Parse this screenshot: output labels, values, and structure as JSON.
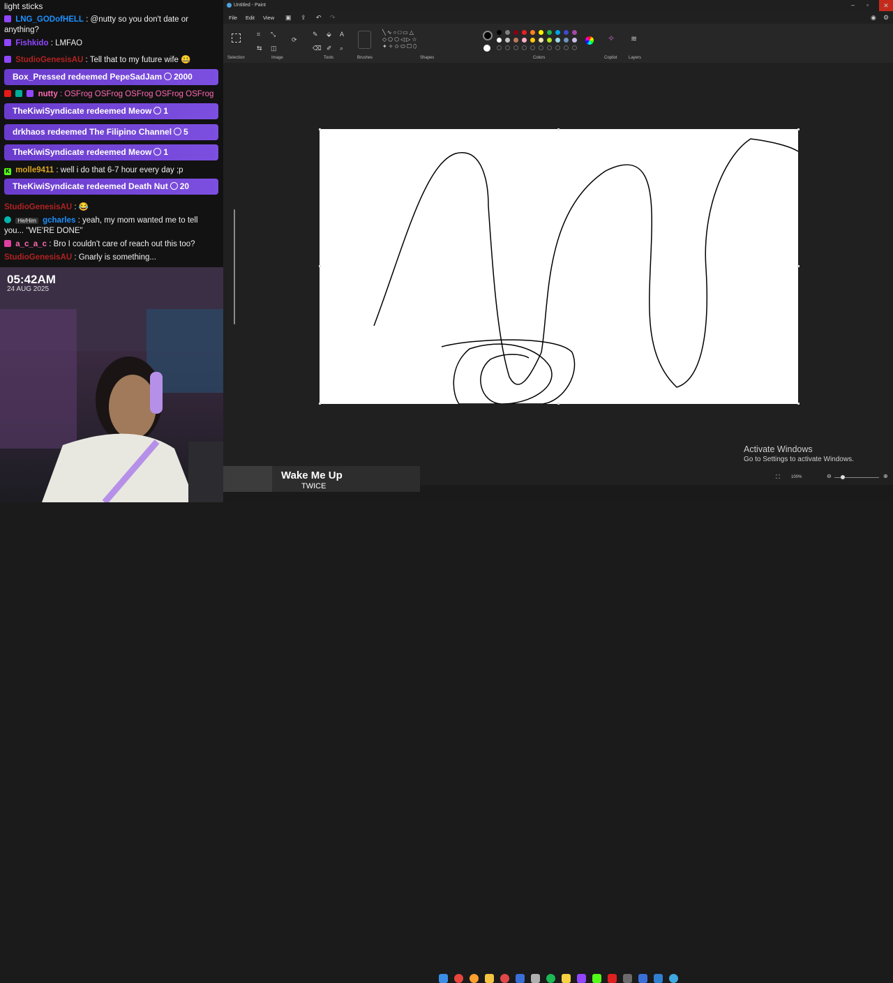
{
  "chat": {
    "messages": [
      {
        "type": "text",
        "user": "",
        "text": "light sticks",
        "user_color": "#efeff1"
      },
      {
        "type": "text",
        "user": "LNG_GODofHELL",
        "text": ": @nutty so you don't date or anything?",
        "user_color": "#1e90ff"
      },
      {
        "type": "text",
        "user": "Fishkido",
        "text": ": LMFAO",
        "user_color": "#9146ff"
      },
      {
        "type": "text",
        "user": "StudioGenesisAU",
        "text": ": Tell that to my future wife 🤐",
        "user_color": "#b22222"
      },
      {
        "type": "redeem",
        "text": "Box_Pressed redeemed PepeSadJam",
        "points": "2000"
      },
      {
        "type": "text",
        "user": "nutty",
        "text": ": OSFrog OSFrog OSFrog OSFrog OSFrog",
        "user_color": "#ff69b4"
      },
      {
        "type": "redeem",
        "text": "TheKiwiSyndicate redeemed Meow",
        "points": "1"
      },
      {
        "type": "redeem",
        "text": "drkhaos redeemed The Filipino Channel",
        "points": "5"
      },
      {
        "type": "redeem",
        "text": "TheKiwiSyndicate redeemed Meow",
        "points": "1"
      },
      {
        "type": "text",
        "user": "molle9411",
        "text": ": well i do that 6-7 hour every day ;p",
        "user_color": "#daa520"
      },
      {
        "type": "redeem",
        "text": "TheKiwiSyndicate redeemed Death Nut",
        "points": "20"
      },
      {
        "type": "text",
        "user": "StudioGenesisAU",
        "text": ": 😂",
        "user_color": "#b22222"
      },
      {
        "type": "text",
        "user": "gcharles",
        "text": ": yeah, my mom wanted me to tell you... \"WE'RE DONE\"",
        "user_color": "#1e90ff",
        "pronoun": "He/Him"
      },
      {
        "type": "text",
        "user": "a_c_a_c",
        "text": ": Bro I couldn't care of reach out this too?",
        "user_color": "#ff69b4"
      },
      {
        "type": "text",
        "user": "StudioGenesisAU",
        "text": ": Gnarly is something...",
        "user_color": "#b22222"
      }
    ]
  },
  "overlay": {
    "time": "05:42AM",
    "date": "24 AUG 2025"
  },
  "paint": {
    "title": "Untitled - Paint",
    "menu": [
      "File",
      "Edit",
      "View"
    ],
    "groups": [
      "Selection",
      "Image",
      "Tools",
      "Brushes",
      "Shapes",
      "Colors",
      "Copilot",
      "Layers"
    ],
    "zoom": "100%",
    "palette_row1": [
      "#000000",
      "#7f7f7f",
      "#880015",
      "#ed1c24",
      "#ff7f27",
      "#fff200",
      "#22b14c",
      "#00a2e8",
      "#3f48cc",
      "#a349a4"
    ],
    "palette_row2": [
      "#ffffff",
      "#c3c3c3",
      "#b97a57",
      "#ffaec9",
      "#ffc90e",
      "#efe4b0",
      "#b5e61d",
      "#99d9ea",
      "#7092be",
      "#c8bfe7"
    ]
  },
  "watermark": {
    "title": "Activate Windows",
    "subtitle": "Go to Settings to activate Windows."
  },
  "now_playing": {
    "song": "Wake Me Up",
    "artist": "TWICE"
  }
}
